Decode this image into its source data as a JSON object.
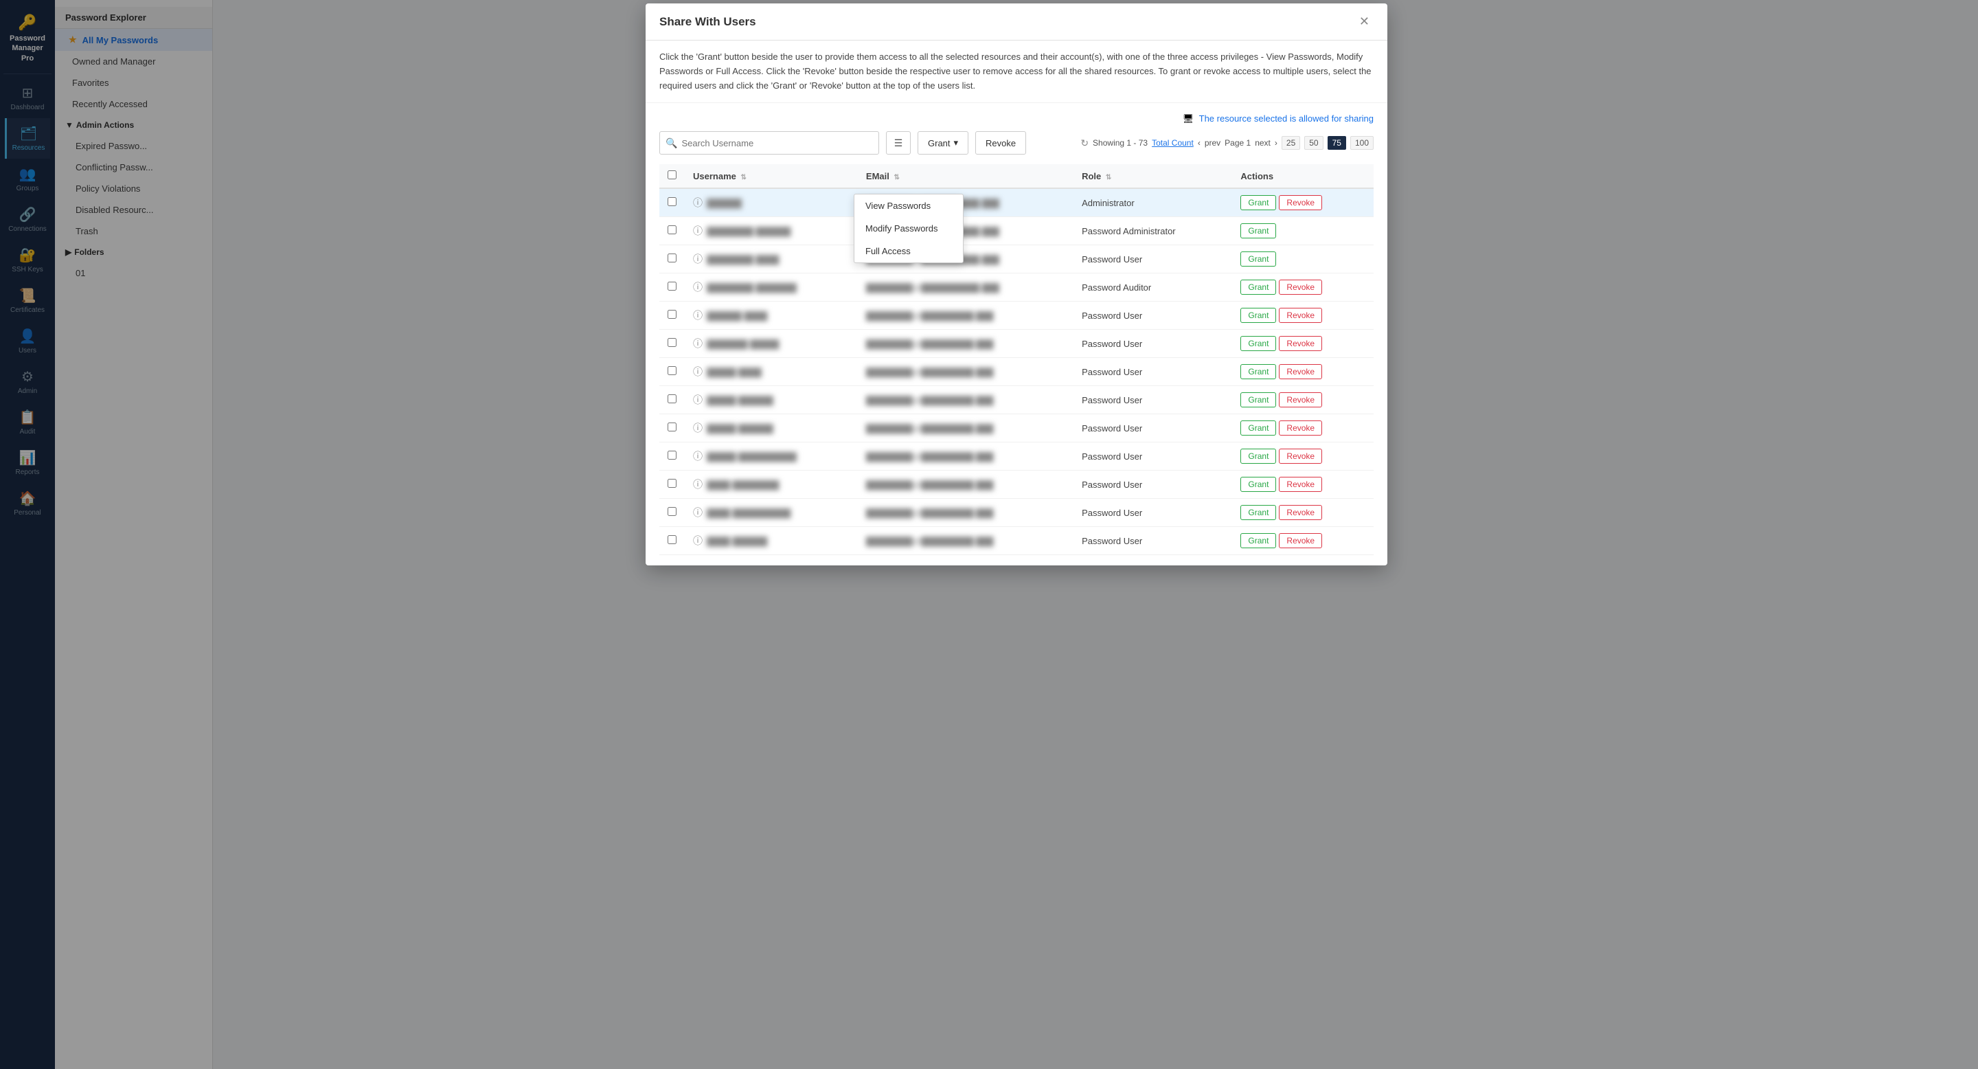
{
  "app": {
    "name": "Password Manager Pro",
    "logo_icon": "🔑"
  },
  "sidebar": {
    "items": [
      {
        "id": "dashboard",
        "label": "Dashboard",
        "icon": "⊞",
        "active": false
      },
      {
        "id": "resources",
        "label": "Resources",
        "icon": "🗂",
        "active": true
      },
      {
        "id": "groups",
        "label": "Groups",
        "icon": "👥",
        "active": false
      },
      {
        "id": "connections",
        "label": "Connections",
        "icon": "🔗",
        "active": false
      },
      {
        "id": "ssh-keys",
        "label": "SSH Keys",
        "icon": "🔐",
        "active": false
      },
      {
        "id": "certificates",
        "label": "Certificates",
        "icon": "📜",
        "active": false
      },
      {
        "id": "users",
        "label": "Users",
        "icon": "👤",
        "active": false
      },
      {
        "id": "admin",
        "label": "Admin",
        "icon": "⚙",
        "active": false
      },
      {
        "id": "audit",
        "label": "Audit",
        "icon": "📋",
        "active": false
      },
      {
        "id": "reports",
        "label": "Reports",
        "icon": "📊",
        "active": false
      },
      {
        "id": "personal",
        "label": "Personal",
        "icon": "🏠",
        "active": false
      }
    ]
  },
  "left_panel": {
    "title": "Password Explorer",
    "nav_items": [
      {
        "id": "all-passwords",
        "label": "All My Passwords",
        "star": true,
        "active": true
      },
      {
        "id": "owned",
        "label": "Owned and Manager",
        "indent": 1
      },
      {
        "id": "favorites",
        "label": "Favorites",
        "indent": 1
      },
      {
        "id": "recently",
        "label": "Recently Accessed",
        "indent": 1
      },
      {
        "id": "admin-actions",
        "label": "Admin Actions",
        "section": true
      },
      {
        "id": "expired",
        "label": "Expired Passwo...",
        "indent": 2
      },
      {
        "id": "conflicting",
        "label": "Conflicting Passw...",
        "indent": 2
      },
      {
        "id": "policy",
        "label": "Policy Violations",
        "indent": 2
      },
      {
        "id": "disabled",
        "label": "Disabled Resourc...",
        "indent": 2
      },
      {
        "id": "trash",
        "label": "Trash",
        "indent": 2
      },
      {
        "id": "folders",
        "label": "Folders",
        "section": true
      },
      {
        "id": "folder-01",
        "label": "01",
        "indent": 2
      }
    ]
  },
  "modal": {
    "title": "Share With Users",
    "description": "Click the 'Grant' button beside the user to provide them access to all the selected resources and their account(s), with one of the three access privileges - View Passwords, Modify Passwords or Full Access. Click the 'Revoke' button beside the respective user to remove access for all the shared resources. To grant or revoke access to multiple users, select the required users and click the 'Grant' or 'Revoke' button at the top of the users list.",
    "sharing_note": "The resource selected is allowed for sharing",
    "search_placeholder": "Search Username",
    "grant_btn": "Grant",
    "revoke_btn": "Revoke",
    "pagination": {
      "showing": "Showing 1 - 73",
      "total_label": "Total Count",
      "page_label": "Page 1",
      "prev": "prev",
      "next": "next",
      "sizes": [
        25,
        50,
        75,
        100
      ],
      "active_size": 75
    },
    "table": {
      "columns": [
        "Username",
        "EMail",
        "Role",
        "Actions"
      ],
      "rows": [
        {
          "username": "██████",
          "email": "████████@██████████.███",
          "role": "Administrator",
          "has_revoke": true,
          "highlighted": true
        },
        {
          "username": "████████ ██████",
          "email": "████████@██████████.███",
          "role": "Password Administrator",
          "has_revoke": false
        },
        {
          "username": "████████ ████",
          "email": "████████@██████████.███",
          "role": "Password User",
          "has_revoke": false
        },
        {
          "username": "████████ ███████",
          "email": "████████@██████████.███",
          "role": "Password Auditor",
          "has_revoke": true
        },
        {
          "username": "██████ ████",
          "email": "████████@█████████.███",
          "role": "Password User",
          "has_revoke": true
        },
        {
          "username": "███████ █████",
          "email": "████████@█████████.███",
          "role": "Password User",
          "has_revoke": true
        },
        {
          "username": "█████ ████",
          "email": "████████@█████████.███",
          "role": "Password User",
          "has_revoke": true
        },
        {
          "username": "█████ ██████",
          "email": "████████@█████████.███",
          "role": "Password User",
          "has_revoke": true
        },
        {
          "username": "█████ ██████",
          "email": "████████@█████████.███",
          "role": "Password User",
          "has_revoke": true
        },
        {
          "username": "█████ ██████████",
          "email": "████████@█████████.███",
          "role": "Password User",
          "has_revoke": true
        },
        {
          "username": "████ ████████",
          "email": "████████@█████████.███",
          "role": "Password User",
          "has_revoke": true
        },
        {
          "username": "████ ██████████",
          "email": "████████@█████████.███",
          "role": "Password User",
          "has_revoke": true
        },
        {
          "username": "████ ██████",
          "email": "████████@█████████.███",
          "role": "Password User",
          "has_revoke": true
        }
      ]
    },
    "dropdown": {
      "items": [
        "View Passwords",
        "Modify Passwords",
        "Full Access"
      ]
    }
  }
}
